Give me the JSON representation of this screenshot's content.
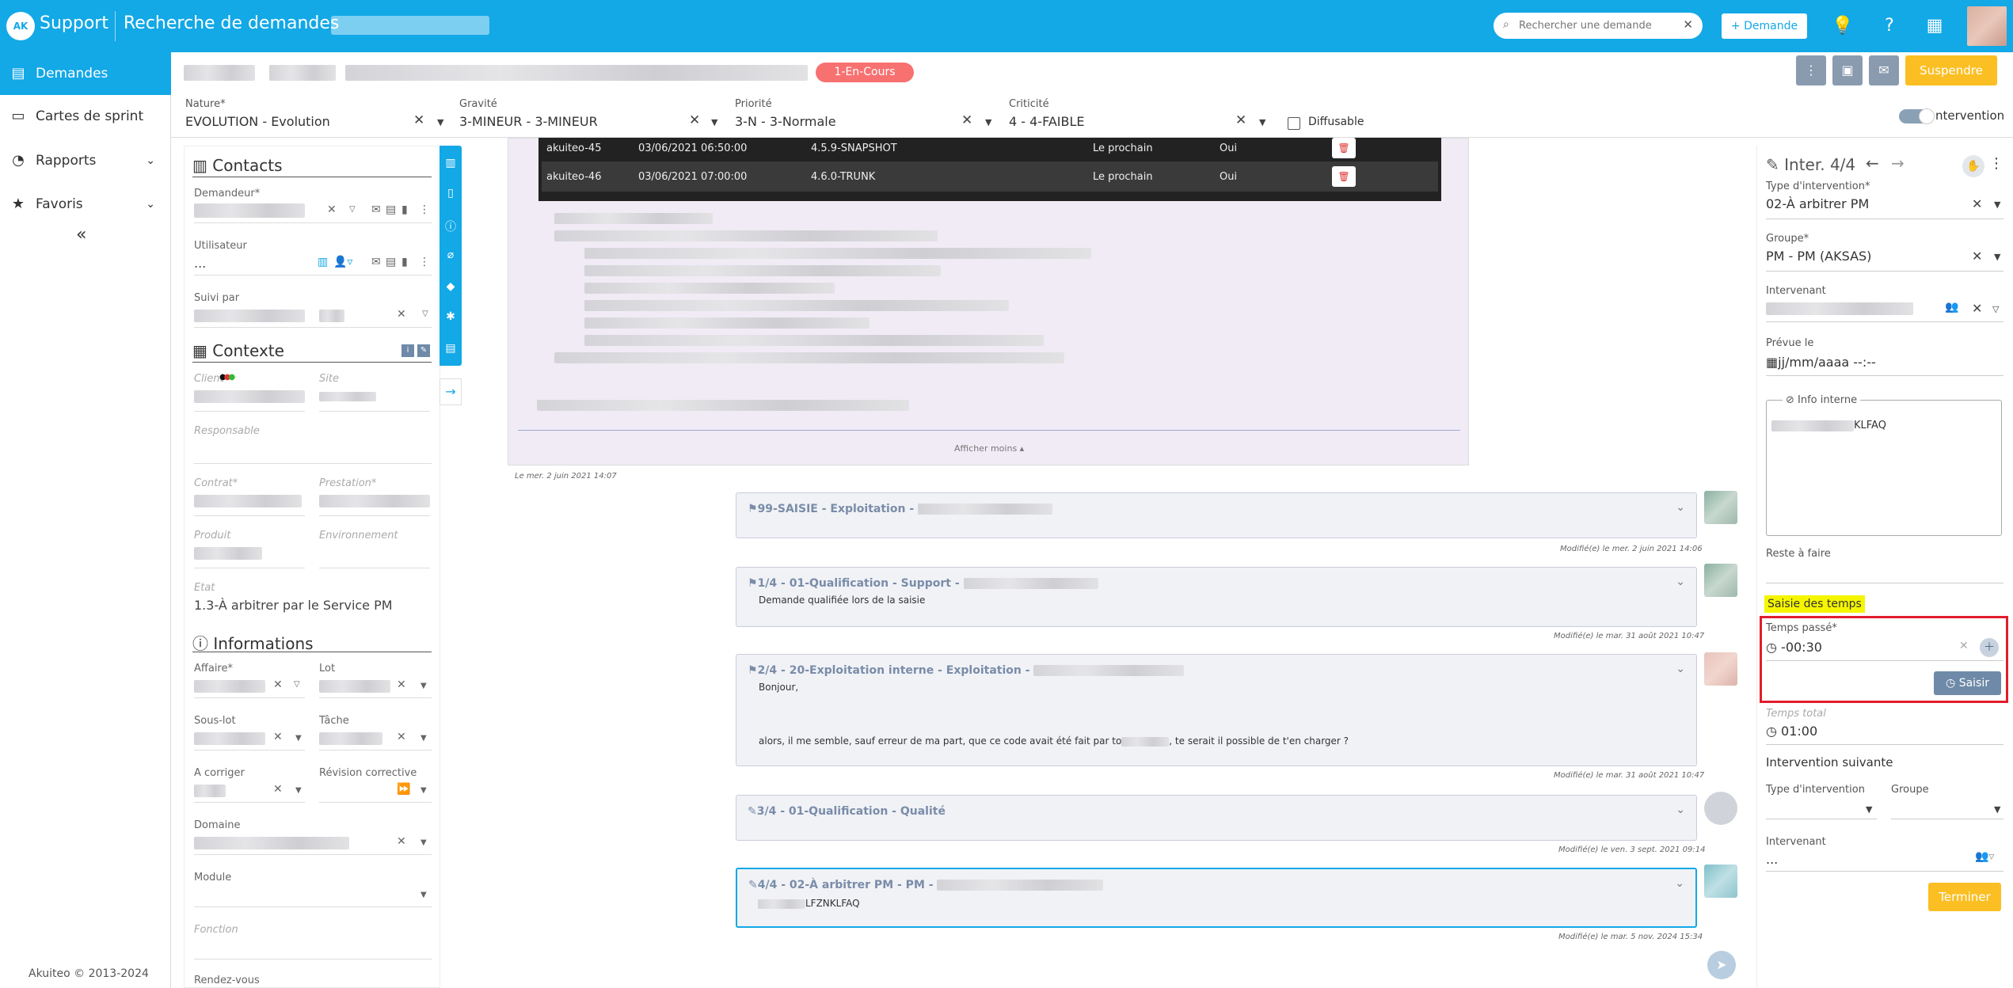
{
  "topbar": {
    "app_name": "Support",
    "page_title": "Recherche de demandes",
    "search_placeholder": "Rechercher une demande",
    "new_button": "+ Demande"
  },
  "sidebar": {
    "items": [
      {
        "label": "Demandes",
        "icon": "chat-icon"
      },
      {
        "label": "Cartes de sprint",
        "icon": "card-icon"
      },
      {
        "label": "Rapports",
        "icon": "gauge-icon"
      },
      {
        "label": "Favoris",
        "icon": "star-icon"
      }
    ],
    "footer": "Akuiteo © 2013-2024"
  },
  "header": {
    "status": "1-En-Cours",
    "suspend_label": "Suspendre",
    "nature_label": "Nature*",
    "nature_value": "EVOLUTION - Evolution",
    "gravite_label": "Gravité",
    "gravite_value": "3-MINEUR - 3-MINEUR",
    "priorite_label": "Priorité",
    "priorite_value": "3-N - 3-Normale",
    "criticite_label": "Criticité",
    "criticite_value": "4 - 4-FAIBLE",
    "diffusable_label": "Diffusable",
    "toggle_label": "ntervention"
  },
  "left_panel": {
    "contacts_title": "Contacts",
    "demandeur_label": "Demandeur*",
    "utilisateur_label": "Utilisateur",
    "utilisateur_value": "...",
    "suivi_label": "Suivi par",
    "contexte_title": "Contexte",
    "client_label": "Client",
    "site_label": "Site",
    "responsable_label": "Responsable",
    "contrat_label": "Contrat*",
    "prestation_label": "Prestation*",
    "produit_label": "Produit",
    "environnement_label": "Environnement",
    "etat_label": "Etat",
    "etat_value": "1.3-À arbitrer par le Service PM",
    "informations_title": "Informations",
    "affaire_label": "Affaire*",
    "lot_label": "Lot",
    "souslot_label": "Sous-lot",
    "tache_label": "Tâche",
    "acorriger_label": "A corriger",
    "revision_label": "Révision corrective",
    "domaine_label": "Domaine",
    "module_label": "Module",
    "fonction_label": "Fonction",
    "rdv_label": "Rendez-vous"
  },
  "table_rows": [
    {
      "name": "akuiteo-45",
      "date": "03/06/2021 06:50:00",
      "version": "4.5.9-SNAPSHOT",
      "when": "Le prochain",
      "flag": "Oui"
    },
    {
      "name": "akuiteo-46",
      "date": "03/06/2021 07:00:00",
      "version": "4.6.0-TRUNK",
      "when": "Le prochain",
      "flag": "Oui"
    }
  ],
  "purple": {
    "afficher_moins": "Afficher moins",
    "date": "Le mer. 2 juin 2021 14:07"
  },
  "cards": [
    {
      "title": "99-SAISIE - Exploitation -",
      "body": "",
      "meta": "Modifié(e) le mer. 2 juin 2021 14:06"
    },
    {
      "title": "1/4 - 01-Qualification - Support -",
      "body": "Demande qualifiée lors de la saisie",
      "meta": "Modifié(e) le mar. 31 août 2021 10:47"
    },
    {
      "title": "2/4 - 20-Exploitation interne - Exploitation -",
      "body1": "Bonjour,",
      "body2a": "alors, il me semble, sauf erreur de ma part, que ce code avait été fait par to",
      "body2b": ", te serait il possible de t'en charger ?",
      "meta": "Modifié(e) le mar. 31 août 2021 10:47"
    },
    {
      "title": "3/4 - 01-Qualification - Qualité",
      "body": "",
      "meta": "Modifié(e) le ven. 3 sept. 2021 09:14"
    },
    {
      "title": "4/4 - 02-À arbitrer PM - PM -",
      "body": "LFZNKLFAQ",
      "meta": "Modifié(e) le mar. 5 nov. 2024 15:34"
    }
  ],
  "right_panel": {
    "title": "Inter. 4/4",
    "type_label": "Type d'intervention*",
    "type_value": "02-À arbitrer PM",
    "groupe_label": "Groupe*",
    "groupe_value": "PM - PM (AKSAS)",
    "intervenant_label": "Intervenant",
    "prevue_label": "Prévue le",
    "prevue_value": "jj/mm/aaaa --:--",
    "info_interne_label": "Info interne",
    "info_interne_value": "KLFAQ",
    "reste_label": "Reste à faire",
    "saisie_label": "Saisie des temps",
    "temps_passe_label": "Temps passé*",
    "temps_passe_value": "-00:30",
    "saisir_label": "Saisir",
    "temps_total_label": "Temps total",
    "temps_total_value": "01:00",
    "suivante_title": "Intervention suivante",
    "next_type_label": "Type d'intervention",
    "next_groupe_label": "Groupe",
    "next_intervenant_label": "Intervenant",
    "next_intervenant_value": "...",
    "terminer_label": "Terminer"
  }
}
